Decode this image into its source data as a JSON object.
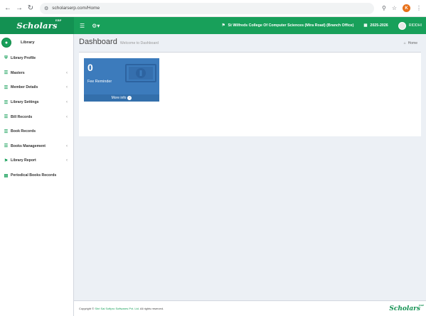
{
  "browser": {
    "url": "scholarserp.com/Home",
    "profile_initial": "K"
  },
  "header": {
    "logo": "Scholars",
    "logo_mark": "ERP",
    "college": "St Wilfreds College Of Computer Sciences (Mira Road) (Branch Office)",
    "year": "2025-2026",
    "user": "RIDDHI"
  },
  "sidebar": {
    "title": "Library",
    "items": [
      {
        "label": "Library Profile",
        "icon": "bank-icon",
        "has_children": false
      },
      {
        "label": "Masters",
        "icon": "list-icon",
        "has_children": true
      },
      {
        "label": "Member Details",
        "icon": "list-icon",
        "has_children": true
      },
      {
        "label": "Library Settings",
        "icon": "list-icon",
        "has_children": true
      },
      {
        "label": "Bill Records",
        "icon": "list-icon",
        "has_children": true
      },
      {
        "label": "Book Records",
        "icon": "list-icon",
        "has_children": false
      },
      {
        "label": "Books Management",
        "icon": "list-icon",
        "has_children": true
      },
      {
        "label": "Library Report",
        "icon": "graduation-cap-icon",
        "has_children": true
      },
      {
        "label": "Periodical Books Records",
        "icon": "file-icon",
        "has_children": false
      }
    ]
  },
  "main": {
    "title": "Dashboard",
    "subtitle": "Welcome to Dashboard",
    "breadcrumb": "Home",
    "fee_box": {
      "count": "0",
      "label": "Fee Reminder",
      "link": "More info",
      "color": "#3c7bbc"
    }
  },
  "footer": {
    "prefix": "Copyright ©",
    "company": "Shri Sai Softpro Softwares Pvt. Ltd.",
    "suffix": "All rights reserved."
  },
  "colors": {
    "brand_green": "#18a05a",
    "info_blue": "#3c7bbc"
  }
}
